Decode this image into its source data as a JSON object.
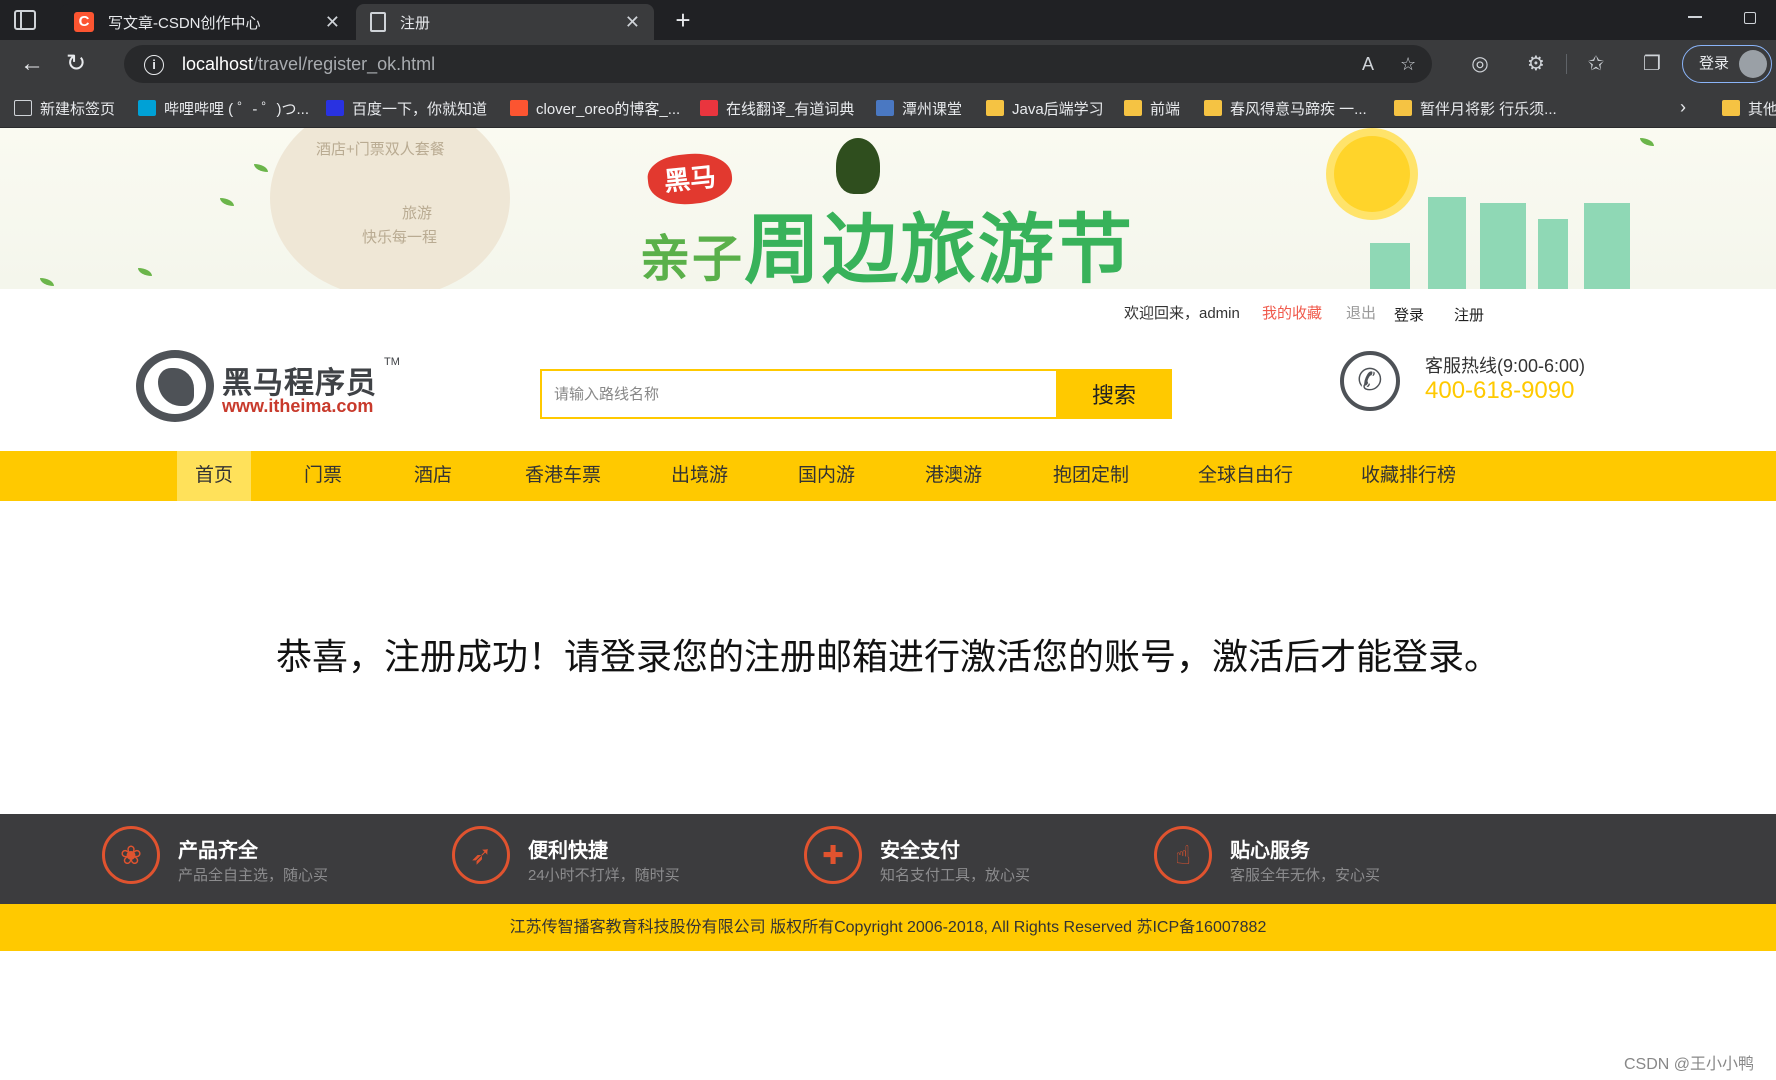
{
  "browser": {
    "tabs": [
      {
        "title": "写文章-CSDN创作中心",
        "icon": "csdn-logo-icon",
        "active": false
      },
      {
        "title": "注册",
        "icon": "document-icon",
        "active": true
      }
    ],
    "new_tab_symbol": "+",
    "address": {
      "host": "localhost",
      "path": "/travel/register_ok.html"
    },
    "login_button": "登录",
    "bookmarks": [
      {
        "label": "新建标签页",
        "icon": "page-icon"
      },
      {
        "label": "哔哩哔哩 ( ゜- ゜)つ...",
        "icon": "bilibili-icon"
      },
      {
        "label": "百度一下，你就知道",
        "icon": "baidu-icon"
      },
      {
        "label": "clover_oreo的博客_...",
        "icon": "csdn-icon"
      },
      {
        "label": "在线翻译_有道词典",
        "icon": "youdao-icon"
      },
      {
        "label": "潭州课堂",
        "icon": "tanzhou-icon"
      },
      {
        "label": "Java后端学习",
        "icon": "folder-icon"
      },
      {
        "label": "前端",
        "icon": "folder-icon"
      },
      {
        "label": "春风得意马蹄疾 一...",
        "icon": "folder-icon"
      },
      {
        "label": "暂伴月将影 行乐须...",
        "icon": "folder-icon"
      },
      {
        "label": "其他",
        "icon": "folder-icon"
      }
    ]
  },
  "banner": {
    "tag": "黑马",
    "headline_small": "亲子",
    "headline": "周边旅游节",
    "cloud_lines": [
      "酒店+门票双人套餐",
      "旅游",
      "快乐每一程"
    ]
  },
  "topbar": {
    "welcome": "欢迎回来，admin",
    "favorites": "我的收藏",
    "logout": "退出",
    "login": "登录",
    "register": "注册"
  },
  "header": {
    "logo_cn": "黑马程序员",
    "logo_tm": "TM",
    "logo_url": "www.itheima.com",
    "search_placeholder": "请输入路线名称",
    "search_button": "搜索",
    "hotline_label": "客服热线(9:00-6:00)",
    "hotline_number": "400-618-9090"
  },
  "nav": {
    "items": [
      "首页",
      "门票",
      "酒店",
      "香港车票",
      "出境游",
      "国内游",
      "港澳游",
      "抱团定制",
      "全球自由行",
      "收藏排行榜"
    ],
    "active_index": 0
  },
  "message": "恭喜，注册成功！请登录您的注册邮箱进行激活您的账号，激活后才能登录。",
  "features": [
    {
      "title": "产品齐全",
      "subtitle": "产品全自主选，随心买",
      "icon": "grid-icon"
    },
    {
      "title": "便利快捷",
      "subtitle": "24小时不打烊，随时买",
      "icon": "rocket-icon"
    },
    {
      "title": "安全支付",
      "subtitle": "知名支付工具，放心买",
      "icon": "shield-icon"
    },
    {
      "title": "贴心服务",
      "subtitle": "客服全年无休，安心买",
      "icon": "thumbs-up-icon"
    }
  ],
  "copyright": "江苏传智播客教育科技股份有限公司 版权所有Copyright 2006-2018, All Rights Reserved 苏ICP备16007882",
  "watermark": "CSDN @王小小鸭",
  "colors": {
    "brand_yellow": "#ffc900",
    "footer_dark": "#3c3c3e",
    "feature_accent": "#e0532f",
    "favorites_link": "#f05a4c"
  }
}
